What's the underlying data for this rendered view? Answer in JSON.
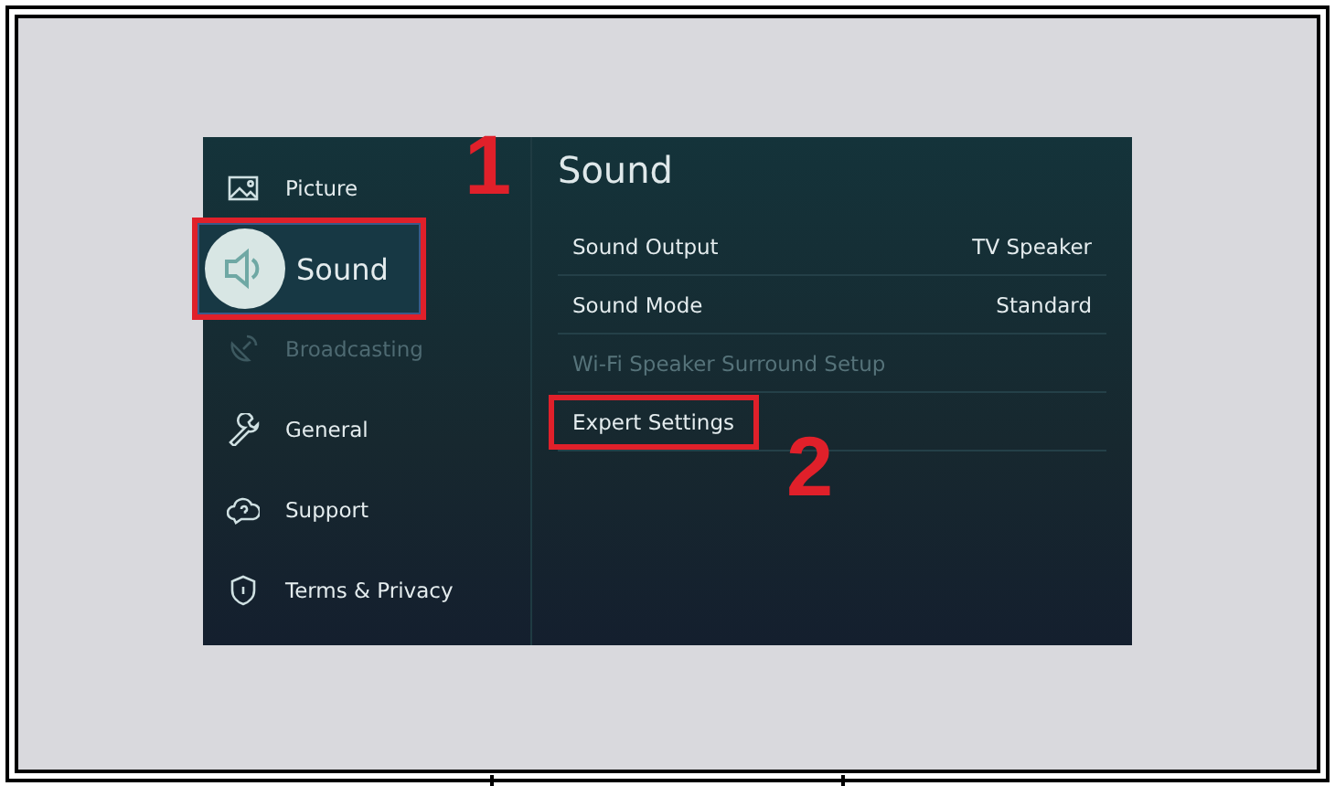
{
  "sidebar": {
    "items": [
      {
        "label": "Picture",
        "kind": "picture",
        "selected": false,
        "disabled": false,
        "highlighted": false
      },
      {
        "label": "Sound",
        "kind": "sound",
        "selected": true,
        "disabled": false,
        "highlighted": true
      },
      {
        "label": "Broadcasting",
        "kind": "broadcast",
        "selected": false,
        "disabled": true,
        "highlighted": false
      },
      {
        "label": "General",
        "kind": "wrench",
        "selected": false,
        "disabled": false,
        "highlighted": false
      },
      {
        "label": "Support",
        "kind": "support",
        "selected": false,
        "disabled": false,
        "highlighted": false
      },
      {
        "label": "Terms & Privacy",
        "kind": "shield",
        "selected": false,
        "disabled": false,
        "highlighted": false
      }
    ]
  },
  "panel": {
    "title": "Sound",
    "rows": [
      {
        "label": "Sound Output",
        "value": "TV Speaker",
        "disabled": false,
        "highlighted": false
      },
      {
        "label": "Sound Mode",
        "value": "Standard",
        "disabled": false,
        "highlighted": false
      },
      {
        "label": "Wi-Fi Speaker Surround Setup",
        "disabled": true,
        "highlighted": false
      },
      {
        "label": "Expert Settings",
        "disabled": false,
        "highlighted": true
      }
    ]
  },
  "annotations": [
    {
      "label": "1"
    },
    {
      "label": "2"
    }
  ]
}
